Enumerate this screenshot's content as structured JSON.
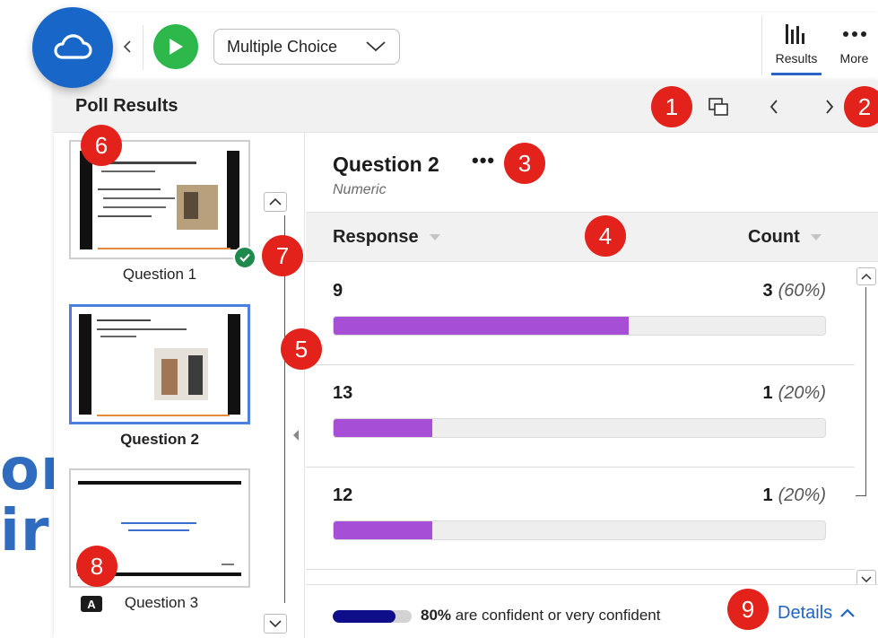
{
  "background": {
    "line1": "or",
    "line2": "ir"
  },
  "toolbar": {
    "logo_icon": "cloud-icon",
    "question_type": "Multiple Choice",
    "tabs": [
      {
        "label": "Results",
        "icon": "bar-chart-icon",
        "active": true
      },
      {
        "label": "More",
        "icon": "ellipsis-icon"
      }
    ]
  },
  "panel": {
    "title": "Poll Results"
  },
  "markers": [
    "1",
    "2",
    "3",
    "4",
    "5",
    "6",
    "7",
    "8",
    "9"
  ],
  "slides": [
    {
      "label": "Question 1",
      "answered": true
    },
    {
      "label": "Question 2",
      "active": true
    },
    {
      "label": "Question 3",
      "badge": "A"
    }
  ],
  "question": {
    "title": "Question 2",
    "more": "•••",
    "type": "Numeric"
  },
  "table": {
    "columns": [
      "Response",
      "Count"
    ],
    "rows": [
      {
        "response": "9",
        "count": "3",
        "percent": "(60%)",
        "fraction": 0.6
      },
      {
        "response": "13",
        "count": "1",
        "percent": "(20%)",
        "fraction": 0.2
      },
      {
        "response": "12",
        "count": "1",
        "percent": "(20%)",
        "fraction": 0.2
      }
    ]
  },
  "footer": {
    "confidence_value": "80%",
    "confidence_fraction": 0.8,
    "confidence_text": "are confident or very confident",
    "details_label": "Details"
  },
  "colors": {
    "accent_blue": "#1f63c6",
    "bar_purple": "#a64ed6",
    "confidence_navy": "#0e0e8a",
    "marker_red": "#e3231b",
    "play_green": "#2eb84c"
  }
}
